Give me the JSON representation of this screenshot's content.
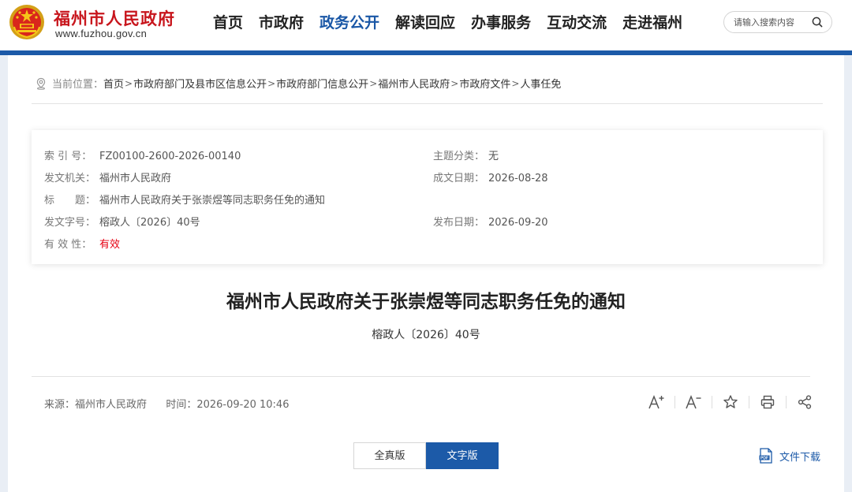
{
  "header": {
    "site_title": "福州市人民政府",
    "site_url": "www.fuzhou.gov.cn",
    "nav": [
      {
        "label": "首页",
        "active": false
      },
      {
        "label": "市政府",
        "active": false
      },
      {
        "label": "政务公开",
        "active": true
      },
      {
        "label": "解读回应",
        "active": false
      },
      {
        "label": "办事服务",
        "active": false
      },
      {
        "label": "互动交流",
        "active": false
      },
      {
        "label": "走进福州",
        "active": false
      }
    ],
    "search": {
      "placeholder": "请输入搜索内容",
      "icon": "search-icon"
    }
  },
  "breadcrumb": {
    "label": "当前位置：",
    "separator": ">",
    "items": [
      "首页",
      "市政府部门及县市区信息公开",
      "市政府部门信息公开",
      "福州市人民政府",
      "市政府文件",
      "人事任免"
    ]
  },
  "meta": {
    "index_label": "索 引 号：",
    "index_value": "FZ00100-2600-2026-00140",
    "topic_label": "主题分类：",
    "topic_value": "无",
    "issuer_label": "发文机关：",
    "issuer_value": "福州市人民政府",
    "written_label": "成文日期：",
    "written_value": "2026-08-28",
    "title_label": "标　　题：",
    "title_value": "福州市人民政府关于张崇煜等同志职务任免的通知",
    "docno_label": "发文字号：",
    "docno_value": "榕政人〔2026〕40号",
    "published_label": "发布日期：",
    "published_value": "2026-09-20",
    "validity_label": "有 效 性：",
    "validity_value": "有效"
  },
  "document": {
    "title": "福州市人民政府关于张崇煜等同志职务任免的通知",
    "number": "榕政人〔2026〕40号",
    "source_label": "来源：",
    "source_value": "福州市人民政府",
    "time_label": "时间：",
    "time_value": "2026-09-20 10:46"
  },
  "tools": [
    "font-increase-icon",
    "font-decrease-icon",
    "star-icon",
    "print-icon",
    "share-icon"
  ],
  "view_toggle": {
    "full": "全真版",
    "text": "文字版",
    "selected": "text"
  },
  "download": {
    "label": "文件下载",
    "icon": "pdf-icon"
  },
  "colors": {
    "brand_red": "#c8161d",
    "accent_blue": "#1c5aa8",
    "valid_red": "#e60012"
  }
}
